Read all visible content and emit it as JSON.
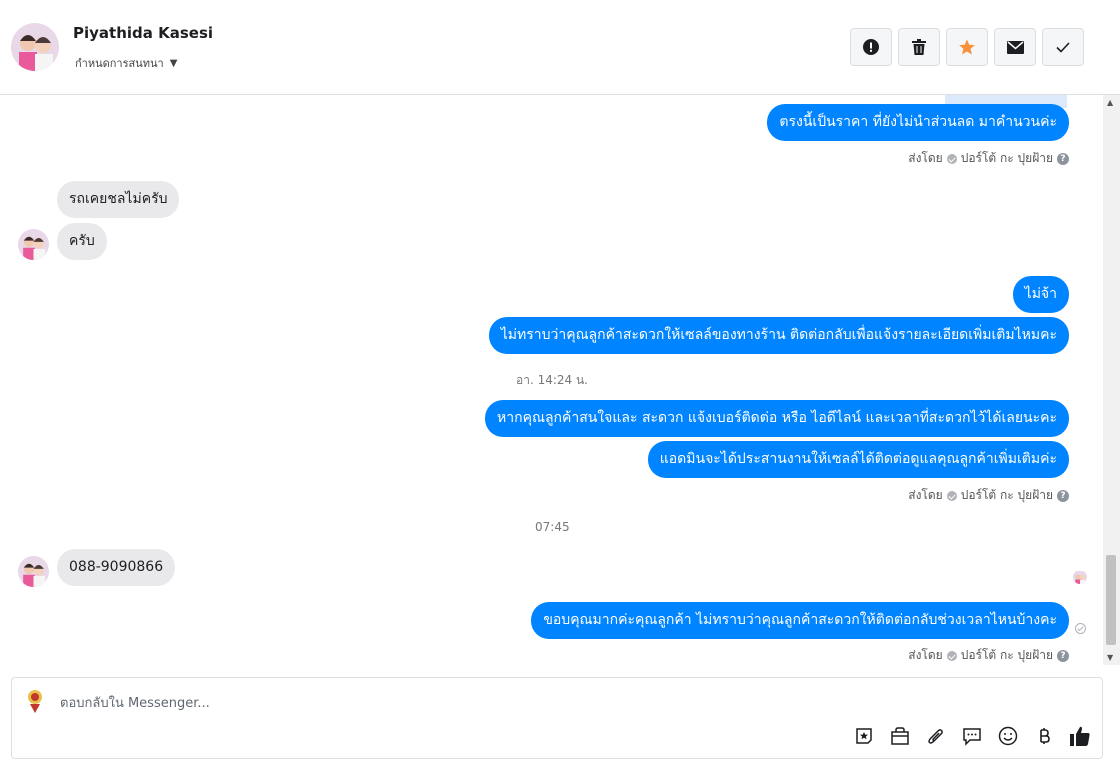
{
  "header": {
    "contact_name": "Piyathida Kasesi",
    "subtitle": "กำหนดการสนทนา",
    "actions": [
      {
        "icon": "alert-icon",
        "name": "report-button"
      },
      {
        "icon": "trash-icon",
        "name": "delete-button"
      },
      {
        "icon": "star-icon",
        "name": "star-button"
      },
      {
        "icon": "mail-icon",
        "name": "mark-unread-button"
      },
      {
        "icon": "check-icon",
        "name": "mark-done-button"
      }
    ]
  },
  "messages": {
    "out1": "ตรงนี้เป็นราคา ที่ยังไม่นำส่วนลด มาคำนวนค่ะ",
    "sent_by_1": "ส่งโดย",
    "sender_1": "ปอร์โต้ กะ ปุยฝ้าย",
    "in1": "รถเคยชลไม่ครับ",
    "in2": "ครับ",
    "out2": "ไม่จ้า",
    "out3": "ไม่ทราบว่าคุณลูกค้าสะดวกให้เซลล์ของทางร้าน ติดต่อกลับเพื่อแจ้งรายละเอียดเพิ่มเติมไหมคะ",
    "time1": "อา. 14:24 น.",
    "out4": "หากคุณลูกค้าสนใจและ สะดวก แจ้งเบอร์ติดต่อ หรือ ไอดีไลน์ และเวลาที่สะดวกไว้ได้เลยนะคะ",
    "out5": "แอดมินจะได้ประสานงานให้เซลล์ได้ติดต่อดูแลคุณลูกค้าเพิ่มเติมค่ะ",
    "sent_by_2": "ส่งโดย",
    "sender_2": "ปอร์โต้ กะ ปุยฝ้าย",
    "time2": "07:45",
    "in3": "088-9090866",
    "out6": "ขอบคุณมากค่ะคุณลูกค้า ไม่ทราบว่าคุณลูกค้าสะดวกให้ติดต่อกลับช่วงเวลาไหนบ้างคะ",
    "sent_by_3": "ส่งโดย",
    "sender_3": "ปอร์โต้ กะ ปุยฝ้าย"
  },
  "composer": {
    "placeholder": "ตอบกลับใน Messenger...",
    "tools": [
      "sticker-icon",
      "shop-icon",
      "attachment-icon",
      "saved-reply-icon",
      "emoji-icon",
      "baht-icon",
      "like-icon"
    ]
  },
  "colors": {
    "outgoing": "#0084ff",
    "incoming": "#e9e9eb",
    "star": "#f7923b"
  }
}
